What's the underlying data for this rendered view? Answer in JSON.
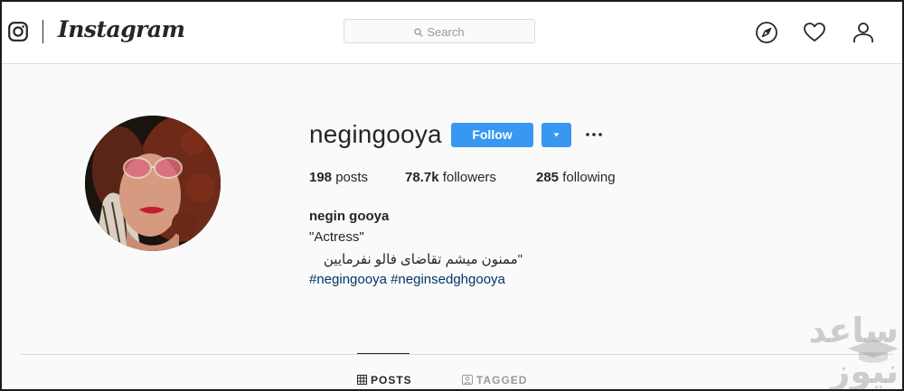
{
  "nav": {
    "wordmark": "Instagram",
    "search_placeholder": "Search",
    "icons": [
      "instagram-logo-icon",
      "compass-icon",
      "heart-icon",
      "person-icon"
    ]
  },
  "profile": {
    "username": "negingooya",
    "follow_label": "Follow",
    "stats": {
      "posts_count": "198",
      "posts_label": "posts",
      "followers_count": "78.7k",
      "followers_label": "followers",
      "following_count": "285",
      "following_label": "following"
    },
    "full_name": "negin gooya",
    "bio_line1": "\"Actress\"",
    "bio_line2": "\"ممنون میشم تقاضای فالو نفرمایین",
    "hashtags": [
      "#negingooya",
      "#neginsedghgooya"
    ]
  },
  "tabs": [
    {
      "label": "POSTS",
      "icon": "grid-icon",
      "active": true
    },
    {
      "label": "TAGGED",
      "icon": "tagged-icon",
      "active": false
    }
  ],
  "watermark": {
    "text": "ساعد نیوز"
  },
  "colors": {
    "accent": "#3897f0",
    "link": "#003569",
    "border": "#dbdbdb",
    "background": "#fafafa"
  }
}
